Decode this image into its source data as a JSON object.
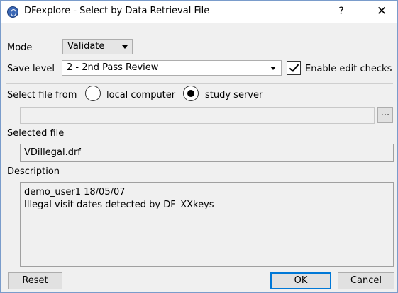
{
  "window": {
    "title": "DFexplore - Select by Data Retrieval File",
    "help_glyph": "?",
    "close_glyph": "✕"
  },
  "mode": {
    "label": "Mode",
    "value": "Validate"
  },
  "save_level": {
    "label": "Save level",
    "value": "2 - 2nd Pass Review"
  },
  "edit_checks": {
    "label": "Enable edit checks",
    "checked": true
  },
  "select_file_from": {
    "label": "Select file from",
    "options": [
      {
        "label": "local computer",
        "selected": false
      },
      {
        "label": "study server",
        "selected": true
      }
    ]
  },
  "path_field": {
    "value": ""
  },
  "browse_button": {
    "label": "..."
  },
  "selected_file": {
    "label": "Selected file",
    "value": "VDillegal.drf"
  },
  "description": {
    "label": "Description",
    "lines": [
      "demo_user1 18/05/07",
      "Illegal visit dates detected by DF_XXkeys"
    ]
  },
  "buttons": {
    "reset": "Reset",
    "ok": "OK",
    "cancel": "Cancel"
  }
}
